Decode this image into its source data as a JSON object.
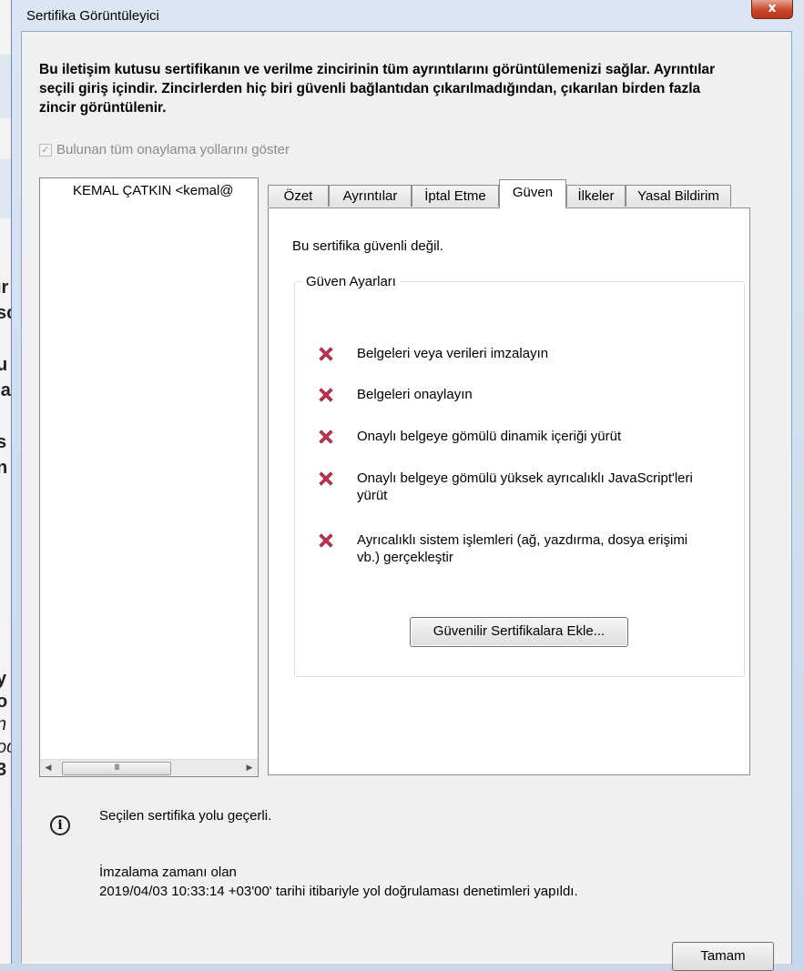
{
  "background_app": {
    "fragments": [
      {
        "text": "ır",
        "italic": false
      },
      {
        "text": "sc",
        "italic": false
      },
      {
        "text": "u",
        "italic": false
      },
      {
        "text": "'a",
        "italic": false
      },
      {
        "text": "s",
        "italic": false
      },
      {
        "text": "n",
        "italic": false
      },
      {
        "text": "y",
        "italic": false
      },
      {
        "text": "o",
        "italic": false
      },
      {
        "text": "n",
        "italic": true
      },
      {
        "text": "oc",
        "italic": true
      },
      {
        "text": "3",
        "italic": false
      }
    ]
  },
  "window": {
    "title": "Sertifika Görüntüleyici",
    "close_glyph": "x"
  },
  "description": "Bu iletişim kutusu sertifikanın ve verilme zincirinin tüm ayrıntılarını görüntülemenizi sağlar. Ayrıntılar seçili giriş içindir. Zincirlerden hiç biri güvenli bağlantıdan çıkarılmadığından, çıkarılan birden fazla zincir görüntülenir.",
  "show_all_paths": {
    "label": "Bulunan tüm onaylama yollarını göster",
    "checked": true,
    "enabled": false
  },
  "chain": {
    "items": [
      "KEMAL ÇATKIN <kemal@"
    ],
    "scroll_thumb_glyph": "III",
    "left_arrow": "◀",
    "right_arrow": "▶"
  },
  "tabs": [
    {
      "label": "Özet",
      "active": false
    },
    {
      "label": "Ayrıntılar",
      "active": false
    },
    {
      "label": "İptal Etme",
      "active": false
    },
    {
      "label": "Güven",
      "active": true
    },
    {
      "label": "İlkeler",
      "active": false
    },
    {
      "label": "Yasal Bildirim",
      "active": false
    }
  ],
  "trust": {
    "status": "Bu sertifika güvenli değil.",
    "group_title": "Güven Ayarları",
    "permissions": [
      {
        "label": "Belgeleri veya verileri imzalayın",
        "allowed": false
      },
      {
        "label": "Belgeleri onaylayın",
        "allowed": false
      },
      {
        "label": "Onaylı belgeye gömülü dinamik içeriği yürüt",
        "allowed": false
      },
      {
        "label": "Onaylı belgeye gömülü yüksek ayrıcalıklı JavaScript'leri yürüt",
        "allowed": false
      },
      {
        "label": "Ayrıcalıklı sistem işlemleri (ağ, yazdırma, dosya erişimi vb.) gerçekleştir",
        "allowed": false
      }
    ],
    "add_button": "Güvenilir Sertifikalara Ekle..."
  },
  "validation": {
    "icon": "info-icon",
    "summary": "Seçilen sertifika yolu geçerli.",
    "detail_line1": "İmzalama zamanı olan",
    "detail_line2": "2019/04/03 10:33:14 +03'00' tarihi itibariyle yol doğrulaması denetimleri yapıldı."
  },
  "ok_button": "Tamam",
  "colors": {
    "denied_icon": "#c4364f",
    "window_frame": "#c6d6ea",
    "close_button": "#c8462a"
  }
}
